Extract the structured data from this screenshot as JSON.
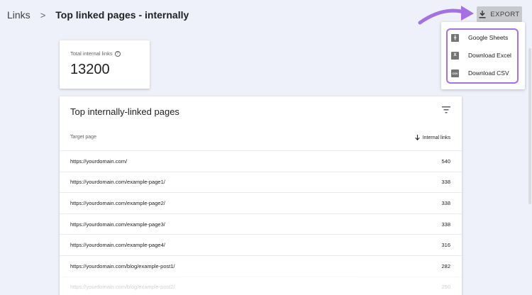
{
  "breadcrumb": {
    "root": "Links",
    "separator": ">",
    "title": "Top linked pages - internally"
  },
  "export": {
    "label": "EXPORT",
    "icon": "download-icon",
    "menu": [
      {
        "label": "Google Sheets",
        "icon": "google-sheets-icon"
      },
      {
        "label": "Download Excel",
        "icon": "excel-icon"
      },
      {
        "label": "Download CSV",
        "icon": "csv-icon"
      }
    ]
  },
  "stat": {
    "label": "Total internal links",
    "value": "13200",
    "help_icon": "help-icon"
  },
  "table": {
    "title": "Top internally-linked pages",
    "filter_icon": "filter-icon",
    "columns": [
      "Target page",
      "Internal links"
    ],
    "sort_icon": "arrow-down-icon",
    "rows": [
      {
        "page": "https://yourdomain.com/",
        "links": "540"
      },
      {
        "page": "https://yourdomain.com/example-page1/",
        "links": "338"
      },
      {
        "page": "https://yourdomain.com/example-page2/",
        "links": "338"
      },
      {
        "page": "https://yourdomain.com/example-page3/",
        "links": "338"
      },
      {
        "page": "https://yourdomain.com/example-page4/",
        "links": "316"
      },
      {
        "page": "https://yourdomain.com/blog/example-post1/",
        "links": "282"
      },
      {
        "page": "https://yourdomain.com/blog/example-post2/",
        "links": "250"
      }
    ]
  },
  "colors": {
    "background": "#eef1f9",
    "highlight_outline": "#a56fe6",
    "arrow": "#a56fe6",
    "export_button": "#c7c9cd"
  }
}
